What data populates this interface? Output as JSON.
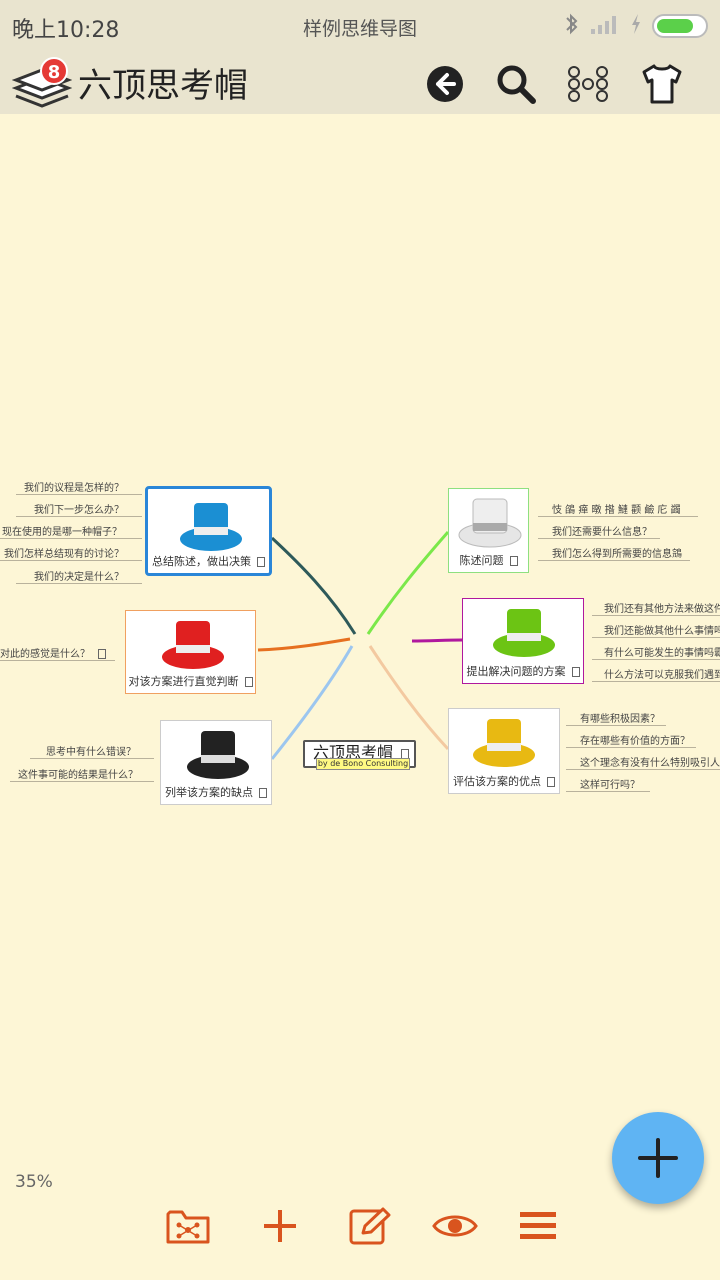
{
  "status_bar": {
    "time": "晚上10:28",
    "title": "样例思维导图"
  },
  "app": {
    "title": "六顶思考帽",
    "badge_count": "8"
  },
  "mindmap": {
    "center": {
      "title": "六顶思考帽",
      "subtitle": "by de Bono Consulting"
    },
    "branches": {
      "blue": {
        "label": "总结陈述，做出决策",
        "hat_color": "#1b8fd3",
        "items": [
          "我们的议程是怎样的？",
          "我们下一步怎么办？",
          "现在使用的是哪一种帽子？",
          "我们怎样总结现有的讨论？",
          "我们的决定是什么？"
        ]
      },
      "red": {
        "label": "对该方案进行直觉判断",
        "hat_color": "#e02020",
        "items": [
          "对此的感觉是什么？"
        ]
      },
      "black": {
        "label": "列举该方案的缺点",
        "hat_color": "#222222",
        "items": [
          "思考中有什么错误？",
          "这件事可能的结果是什么？"
        ]
      },
      "white": {
        "label": "陈述问题",
        "hat_color": "#e6e6e6",
        "items": [
          "忮 鵮 瘅 暾 揝 鰱 颧 鹼 庀 蠲",
          "我们还需要什么信息？",
          "我们怎么得到所需要的信息鵍"
        ]
      },
      "green": {
        "label": "提出解决问题的方案",
        "hat_color": "#6cc414",
        "items": [
          "我们还有其他方法来做这件",
          "我们还能做其他什么事情吗",
          "有什么可能发生的事情吗霸",
          "什么方法可以克服我们遇到"
        ]
      },
      "yellow": {
        "label": "评估该方案的优点",
        "hat_color": "#e8b912",
        "items": [
          "有哪些积极因素？",
          "存在哪些有价值的方面？",
          "这个理念有没有什么特别吸引人",
          "这样可行吗？"
        ]
      }
    }
  },
  "zoom": "35%",
  "colors": {
    "background": "#fdf6d6",
    "bar": "#e9e4cf",
    "accent": "#d9541e",
    "fab": "#5fb4f3"
  },
  "icons": {
    "back": "back-arrow-icon",
    "search": "search-icon",
    "layout": "layout-nodes-icon",
    "theme": "tshirt-icon",
    "folder": "mindmap-folder-icon",
    "add": "plus-icon",
    "edit": "edit-icon",
    "view": "eye-icon",
    "menu": "menu-icon"
  }
}
